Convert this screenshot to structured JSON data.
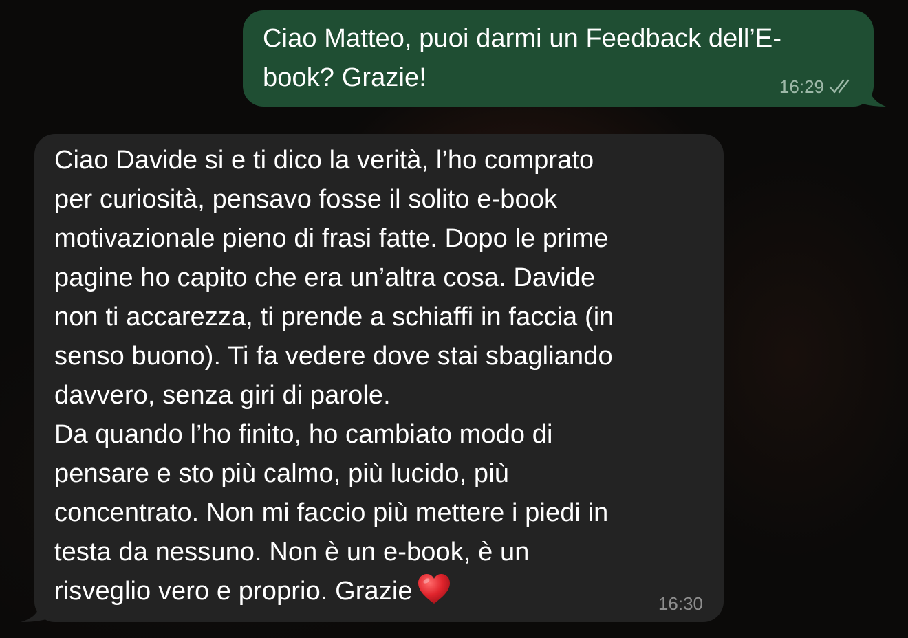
{
  "conversation": {
    "messages": [
      {
        "direction": "outgoing",
        "lines": [
          "Ciao Matteo, puoi darmi un Feedback dell’E-",
          "book? Grazie!"
        ],
        "time": "16:29",
        "status_icon": "double-check-icon"
      },
      {
        "direction": "incoming",
        "lines": [
          "Ciao Davide si e ti dico la verità, l’ho comprato",
          "per curiosità, pensavo fosse il solito e-book",
          "motivazionale pieno di frasi fatte. Dopo le prime",
          "pagine ho capito che era un’altra cosa. Davide",
          "non ti accarezza, ti prende a schiaffi in faccia (in",
          "senso buono). Ti fa vedere dove stai sbagliando",
          "davvero, senza giri di parole.",
          "Da quando l’ho finito, ho cambiato modo di",
          "pensare e sto più calmo, più lucido, più",
          "concentrato. Non mi faccio più mettere i piedi in",
          "testa da nessuno. Non è un e-book, è un",
          "risveglio vero e proprio. Grazie"
        ],
        "trailing_emoji": "heart-icon",
        "time": "16:30"
      }
    ]
  },
  "colors": {
    "outgoing_bubble": "#1f4e33",
    "incoming_bubble": "#232323",
    "heart": "#e0242c",
    "background": "#0b0a09"
  }
}
